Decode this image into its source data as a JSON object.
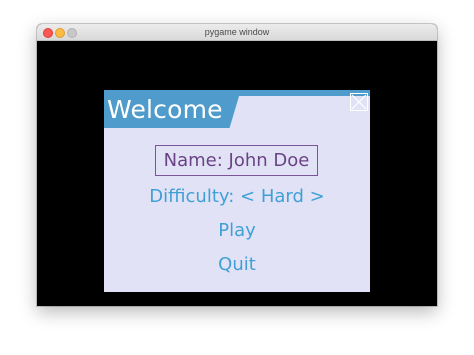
{
  "window": {
    "title": "pygame window"
  },
  "menu": {
    "title": "Welcome",
    "close_icon": "close-x-icon",
    "items": {
      "name": "Name: John Doe",
      "difficulty": "Difficulty: < Hard >",
      "play": "Play",
      "quit": "Quit"
    }
  },
  "colors": {
    "header": "#4f9bcb",
    "panel_background": "#e2e2f6",
    "item_text": "#3fa0d6",
    "selected_text": "#6a4386",
    "selected_border": "#7a5597",
    "game_background": "#000000"
  }
}
